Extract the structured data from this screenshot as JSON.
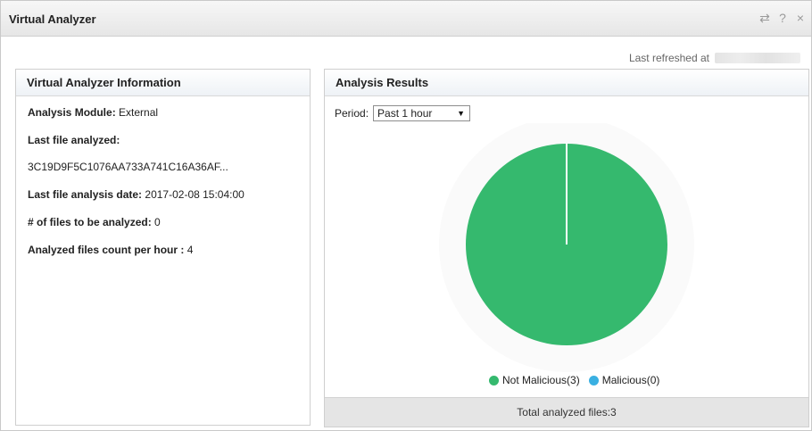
{
  "window": {
    "title": "Virtual Analyzer",
    "icons": [
      "refresh-icon",
      "help-icon",
      "close-icon"
    ]
  },
  "refresh": {
    "label": "Last refreshed at"
  },
  "info_panel": {
    "title": "Virtual Analyzer Information",
    "rows": [
      {
        "label": "Analysis Module:",
        "value": "External"
      },
      {
        "label": "Last file analyzed:",
        "value": ""
      },
      {
        "label": "",
        "value": "3C19D9F5C1076AA733A741C16A36AF..."
      },
      {
        "label": "Last file analysis date:",
        "value": "2017-02-08 15:04:00"
      },
      {
        "label": "# of files to be analyzed:",
        "value": "0"
      },
      {
        "label": "Analyzed files count per hour :",
        "value": "4"
      }
    ]
  },
  "results_panel": {
    "title": "Analysis Results",
    "period_label": "Period:",
    "period_value": "Past 1 hour",
    "footer": "Total analyzed files:3"
  },
  "chart_data": {
    "type": "pie",
    "categories": [
      "Not Malicious",
      "Malicious"
    ],
    "values": [
      3,
      0
    ],
    "legend_labels": [
      "Not Malicious(3)",
      "Malicious(0)"
    ],
    "colors": [
      "#35b96e",
      "#3ab0e2"
    ],
    "legend_placement": "bottom"
  }
}
